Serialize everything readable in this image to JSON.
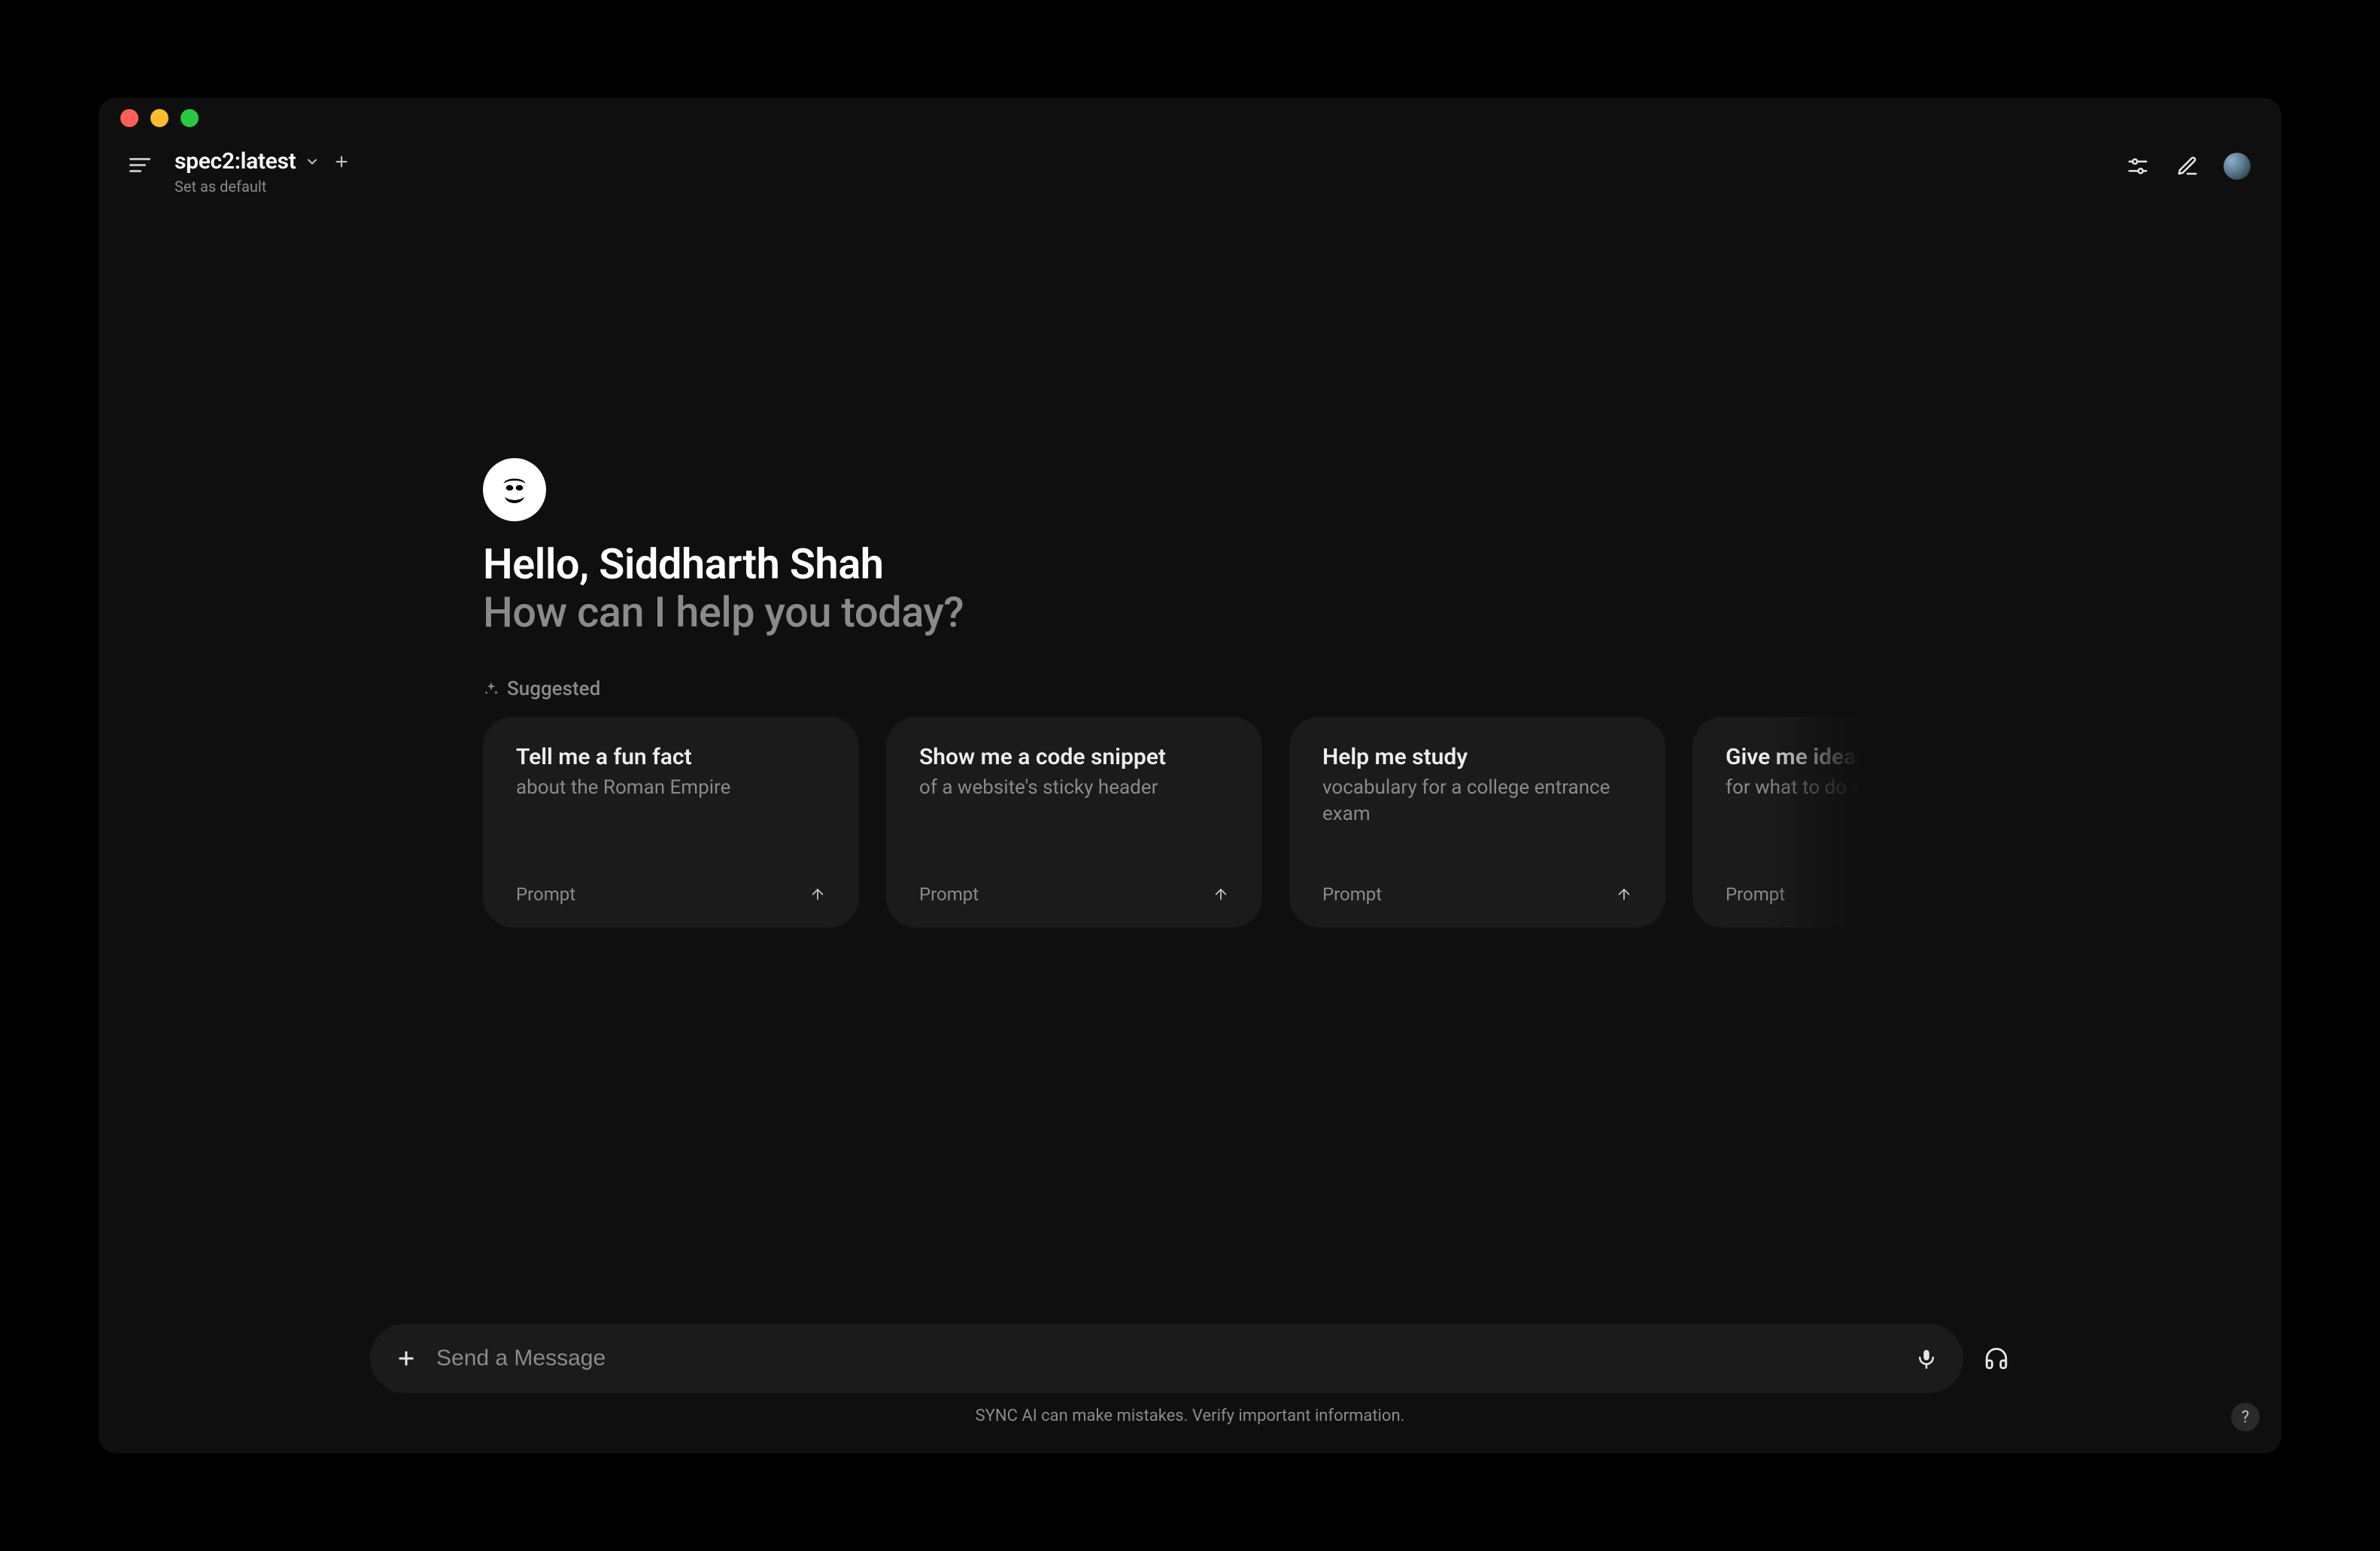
{
  "header": {
    "model": "spec2:latest",
    "set_default": "Set as default"
  },
  "greeting": {
    "hello": "Hello, Siddharth Shah",
    "subtitle": "How can I help you today?"
  },
  "suggested_label": "Suggested",
  "cards": [
    {
      "title": "Tell me a fun fact",
      "subtitle": "about the Roman Empire",
      "foot": "Prompt"
    },
    {
      "title": "Show me a code snippet",
      "subtitle": "of a website's sticky header",
      "foot": "Prompt"
    },
    {
      "title": "Help me study",
      "subtitle": "vocabulary for a college entrance exam",
      "foot": "Prompt"
    },
    {
      "title": "Give me ideas",
      "subtitle": "for what to do with my kids' a",
      "foot": "Prompt"
    }
  ],
  "composer": {
    "placeholder": "Send a Message"
  },
  "disclaimer": "SYNC AI can make mistakes. Verify important information.",
  "help": "?"
}
